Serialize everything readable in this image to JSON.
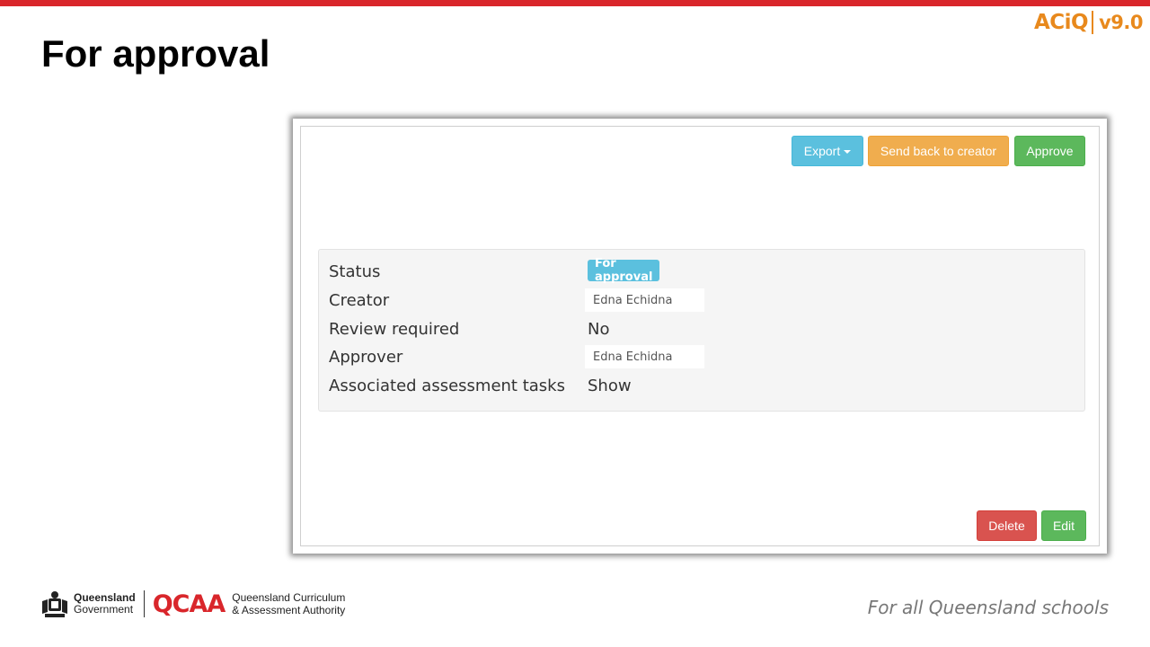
{
  "slide": {
    "title": "For approval",
    "brand": {
      "name": "ACiQ",
      "version": "v9.0"
    },
    "tagline": "For all Queensland schools",
    "footer": {
      "gov_line1": "Queensland",
      "gov_line2": "Government",
      "qcaa": "QCAA",
      "qcaa_line1": "Queensland Curriculum",
      "qcaa_line2": "& Assessment Authority"
    }
  },
  "toolbar": {
    "export_label": "Export",
    "send_back_label": "Send back to creator",
    "approve_label": "Approve"
  },
  "details": {
    "status": {
      "label": "Status",
      "value": "For approval"
    },
    "creator": {
      "label": "Creator",
      "value": "Edna Echidna"
    },
    "review": {
      "label": "Review required",
      "value": "No"
    },
    "approver": {
      "label": "Approver",
      "value": "Edna Echidna"
    },
    "tasks": {
      "label": "Associated assessment tasks",
      "value": "Show"
    }
  },
  "actions": {
    "delete_label": "Delete",
    "edit_label": "Edit"
  },
  "colors": {
    "accent_red": "#d9262b",
    "brand_orange": "#e8891d",
    "info": "#5bc0de",
    "warning": "#f0ad4e",
    "success": "#5cb85c",
    "danger": "#d9534f",
    "link": "#337ab7"
  }
}
